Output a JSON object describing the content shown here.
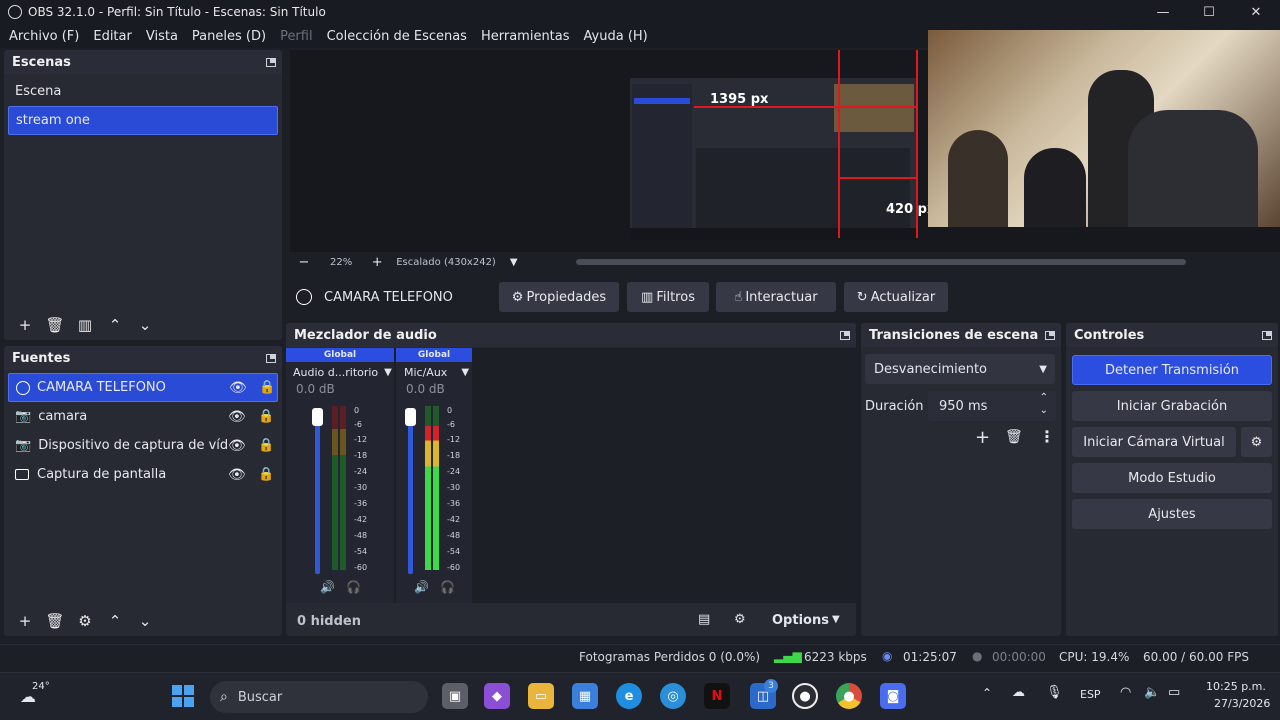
{
  "window": {
    "title": "OBS 32.1.0 - Perfil: Sin Título - Escenas: Sin Título",
    "minimize": "—",
    "maximize": "☐",
    "close": "✕"
  },
  "menu": [
    "Archivo (F)",
    "Editar",
    "Vista",
    "Paneles (D)",
    "Perfil",
    "Colección de Escenas",
    "Herramientas",
    "Ayuda (H)"
  ],
  "preview": {
    "zoom": "22%",
    "minus": "−",
    "plus": "+",
    "scaling": "Escalado (430x242)",
    "measure_w": "1395 px",
    "measure_h": "420 px"
  },
  "source_bar": {
    "source": "CAMARA TELEFONO",
    "props": "Propiedades",
    "filters": "Filtros",
    "interact": "Interactuar",
    "refresh": "Actualizar"
  },
  "scenes": {
    "title": "Escenas",
    "items": [
      "Escena",
      "stream one"
    ],
    "selected": 1
  },
  "sources": {
    "title": "Fuentes",
    "items": [
      {
        "name": "CAMARA TELEFONO",
        "icon": "globe-icon",
        "selected": true
      },
      {
        "name": "camara",
        "icon": "camera-icon"
      },
      {
        "name": "Dispositivo de captura de vídeo",
        "icon": "camera-icon"
      },
      {
        "name": "Captura de pantalla",
        "icon": "monitor-icon"
      }
    ]
  },
  "mixer": {
    "title": "Mezclador de audio",
    "channels": [
      {
        "global": "Global",
        "name": "Audio d...ritorio",
        "db": "0.0 dB",
        "level_l": 0.0,
        "level_r": 0.0
      },
      {
        "global": "Global",
        "name": "Mic/Aux",
        "db": "0.0 dB",
        "level_l": 0.88,
        "level_r": 0.88
      }
    ],
    "ticks": [
      "0",
      "-6",
      "-12",
      "-18",
      "-24",
      "-30",
      "-36",
      "-42",
      "-48",
      "-54",
      "-60"
    ],
    "hidden": "0 hidden",
    "options": "Options"
  },
  "transitions": {
    "title": "Transiciones de escena",
    "selected": "Desvanecimiento",
    "duration_label": "Duración",
    "duration": "950 ms"
  },
  "controls": {
    "title": "Controles",
    "stop_stream": "Detener Transmisión",
    "start_rec": "Iniciar Grabación",
    "virtual_cam": "Iniciar Cámara Virtual",
    "studio": "Modo Estudio",
    "settings": "Ajustes"
  },
  "status": {
    "dropped": "Fotogramas Perdidos 0 (0.0%)",
    "kbps": "6223 kbps",
    "stream_time": "01:25:07",
    "rec_time": "00:00:00",
    "cpu": "CPU: 19.4%",
    "fps": "60.00 / 60.00 FPS"
  },
  "taskbar": {
    "temp": "24°",
    "search": "Buscar",
    "badge": "3",
    "lang": "ESP",
    "time": "10:25 p.m.",
    "date": "27/3/2026"
  },
  "colors": {
    "accent": "#2b4ee0",
    "bg": "#1d1f26",
    "dock": "#272a33"
  }
}
